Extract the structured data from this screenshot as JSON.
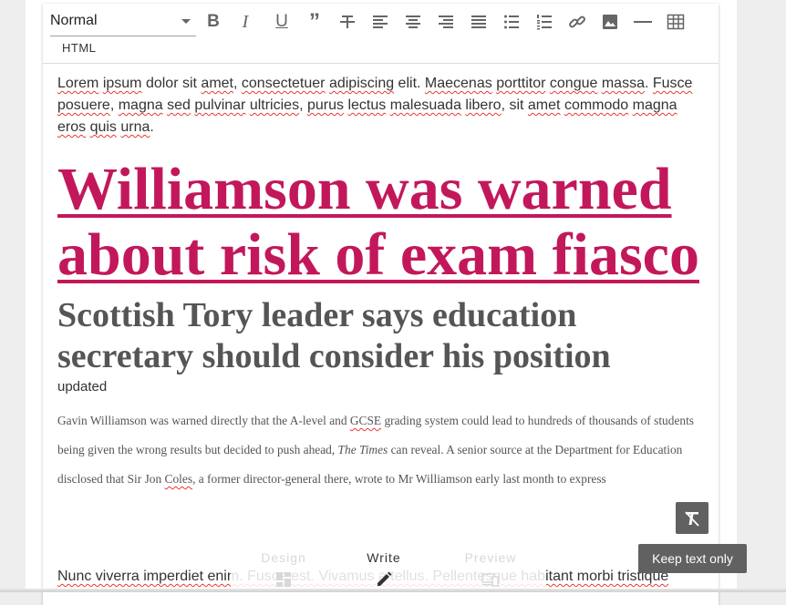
{
  "toolbar": {
    "format_value": "Normal",
    "bold": "B",
    "italic": "I",
    "underline": "U",
    "quote": "”",
    "html_label": "HTML",
    "icons": [
      "bold-icon",
      "italic-icon",
      "underline-icon",
      "quote-icon",
      "strikethrough-icon",
      "align-left-icon",
      "align-center-icon",
      "align-right-icon",
      "align-justify-icon",
      "bullet-list-icon",
      "numbered-list-icon",
      "link-icon",
      "image-icon",
      "horizontal-rule-icon",
      "table-icon"
    ]
  },
  "content": {
    "lorem_words": [
      "Lorem",
      " ",
      "ipsum",
      " dolor sit ",
      "amet",
      ", ",
      "consectetuer",
      " ",
      "adipiscing",
      " elit. ",
      "Maecenas",
      " ",
      "porttitor",
      " ",
      "congue",
      " ",
      "massa",
      ". ",
      "Fusce",
      " ",
      "posuere",
      ", ",
      "magna",
      " ",
      "sed",
      " ",
      "pulvinar",
      " ",
      "ultricies",
      ", ",
      "purus",
      " ",
      "lectus",
      " ",
      "malesuada",
      " ",
      "libero",
      ", sit ",
      "amet",
      " ",
      "commodo",
      " ",
      "magna",
      " ",
      "eros",
      " ",
      "quis",
      " ",
      "urna",
      "."
    ],
    "headline": "Williamson was warned about risk of exam fiasco",
    "subhead": "Scottish Tory leader says education secretary should consider his position",
    "updated": "updated",
    "body_before_gcse": "Gavin Williamson was warned directly that the A-level and ",
    "gcse": "GCSE",
    "body_after_gcse": " grading system could lead to hundreds of thousands of students being given the wrong results but decided to push ahead, ",
    "the_times": "The Times",
    "body_end": " can reveal. A senior source at the Department for Education disclosed that Sir Jon ",
    "coles": "Coles",
    "body_tail": ", a former director-general there, wrote to Mr Williamson early last month to express",
    "last_para": "Nunc viverra imperdiet enim. Fusce est. Vivamus a tellus. Pellentesque habitant morbi tristique"
  },
  "modes": {
    "design": "Design",
    "write": "Write",
    "preview": "Preview"
  },
  "tooltip": "Keep text only",
  "colors": {
    "headline": "#c2185b",
    "spell_underline": "#e53935",
    "tooltip_bg": "#616161"
  }
}
